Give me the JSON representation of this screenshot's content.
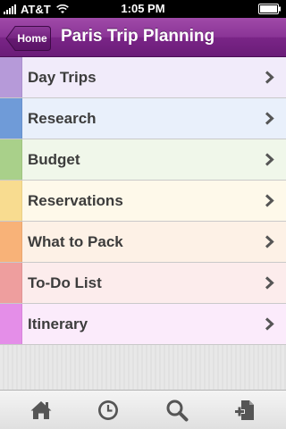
{
  "status_bar": {
    "carrier": "AT&T",
    "time": "1:05 PM"
  },
  "nav": {
    "back_label": "Home",
    "title": "Paris Trip Planning",
    "color": "#7a2587"
  },
  "sections": [
    {
      "label": "Day Trips",
      "tab_color": "#b69ad9",
      "row_color": "#f1ebfa"
    },
    {
      "label": "Research",
      "tab_color": "#6f9bd8",
      "row_color": "#e9f0fb"
    },
    {
      "label": "Budget",
      "tab_color": "#a9d08a",
      "row_color": "#f0f7ea"
    },
    {
      "label": "Reservations",
      "tab_color": "#f8dc90",
      "row_color": "#fef9ea"
    },
    {
      "label": "What to Pack",
      "tab_color": "#f8b278",
      "row_color": "#fdf1e6"
    },
    {
      "label": "To-Do List",
      "tab_color": "#ee9e9e",
      "row_color": "#fcecec"
    },
    {
      "label": "Itinerary",
      "tab_color": "#e48ee8",
      "row_color": "#fbebfb"
    }
  ],
  "tab_bar": {
    "items": [
      {
        "icon": "home-icon"
      },
      {
        "icon": "clock-icon"
      },
      {
        "icon": "search-icon"
      },
      {
        "icon": "new-page-icon"
      }
    ]
  }
}
